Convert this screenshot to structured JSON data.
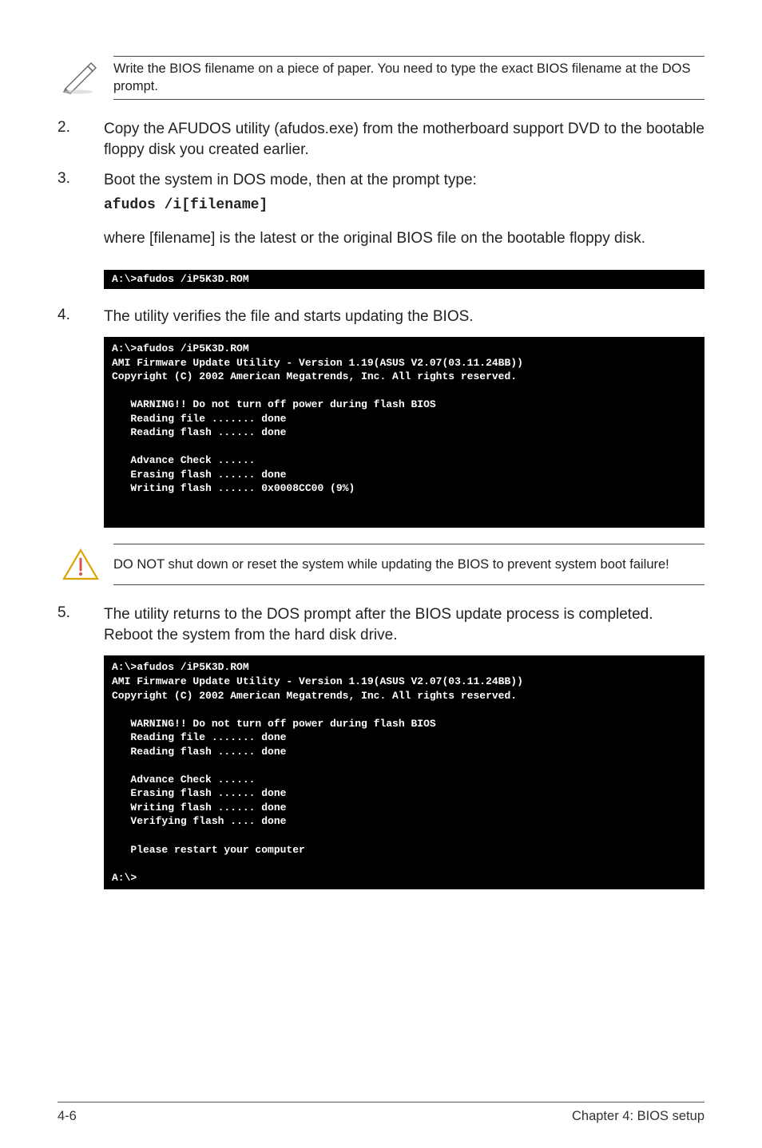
{
  "notes": {
    "top": "Write the BIOS filename on a piece of paper. You need to type the exact BIOS filename at the DOS prompt.",
    "warn": "DO NOT shut down or reset the system while updating the BIOS to prevent system boot failure!"
  },
  "steps": {
    "s2": {
      "num": "2.",
      "text": "Copy the AFUDOS utility (afudos.exe) from the motherboard support DVD to the bootable floppy disk you created earlier."
    },
    "s3": {
      "num": "3.",
      "text": "Boot the system in DOS mode, then at the prompt type:",
      "code": "afudos /i[filename]",
      "sub": "where [filename] is the latest or the original BIOS file on the bootable floppy disk."
    },
    "s4": {
      "num": "4.",
      "text": "The utility verifies the file and starts updating the BIOS."
    },
    "s5": {
      "num": "5.",
      "text": "The utility returns to the DOS prompt after the BIOS update process is completed. Reboot the system from the hard disk drive."
    }
  },
  "terminals": {
    "t1": "A:\\>afudos /iP5K3D.ROM",
    "t2": "A:\\>afudos /iP5K3D.ROM\nAMI Firmware Update Utility - Version 1.19(ASUS V2.07(03.11.24BB))\nCopyright (C) 2002 American Megatrends, Inc. All rights reserved.\n\n   WARNING!! Do not turn off power during flash BIOS\n   Reading file ....... done\n   Reading flash ...... done\n\n   Advance Check ......\n   Erasing flash ...... done\n   Writing flash ...... 0x0008CC00 (9%)",
    "t3": "A:\\>afudos /iP5K3D.ROM\nAMI Firmware Update Utility - Version 1.19(ASUS V2.07(03.11.24BB))\nCopyright (C) 2002 American Megatrends, Inc. All rights reserved.\n\n   WARNING!! Do not turn off power during flash BIOS\n   Reading file ....... done\n   Reading flash ...... done\n\n   Advance Check ......\n   Erasing flash ...... done\n   Writing flash ...... done\n   Verifying flash .... done\n\n   Please restart your computer\n\nA:\\>"
  },
  "footer": {
    "left": "4-6",
    "right": "Chapter 4: BIOS setup"
  }
}
